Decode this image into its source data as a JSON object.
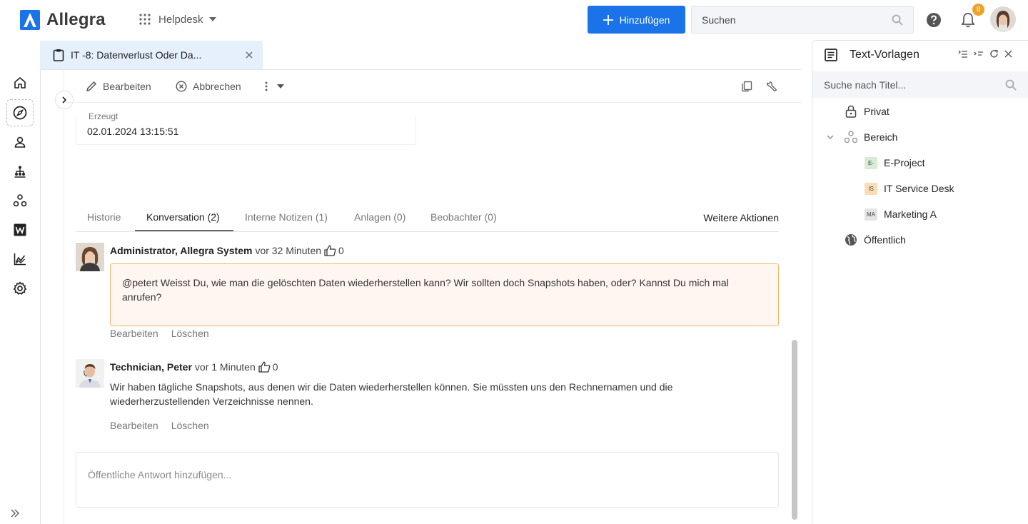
{
  "app": {
    "name": "Allegra",
    "module": "Helpdesk",
    "add_button": "Hinzufügen",
    "search_placeholder": "Suchen",
    "notification_count": "8",
    "brand_color": "#1a73e8"
  },
  "document_tab": {
    "title": "IT -8: Datenverlust Oder Da..."
  },
  "toolbar": {
    "edit": "Bearbeiten",
    "cancel": "Abbrechen"
  },
  "field": {
    "label": "Erzeugt",
    "value": "02.01.2024 13:15:51"
  },
  "conversation_tabs": [
    {
      "label": "Historie"
    },
    {
      "label": "Konversation (2)"
    },
    {
      "label": "Interne Notizen (1)"
    },
    {
      "label": "Anlagen (0)"
    },
    {
      "label": "Beobachter (0)"
    }
  ],
  "more_actions": "Weitere Aktionen",
  "comments": [
    {
      "author": "Administrator, Allegra System",
      "time": "vor 32 Minuten",
      "likes": "0",
      "text": "@petert Weisst Du, wie man die gelöschten Daten wiederherstellen kann? Wir sollten doch Snapshots haben, oder? Kannst Du mich mal anrufen?",
      "edit": "Bearbeiten",
      "delete": "Löschen"
    },
    {
      "author": "Technician, Peter",
      "time": "vor 1 Minuten",
      "likes": "0",
      "text": "Wir haben tägliche Snapshots, aus denen wir die Daten wiederherstellen können. Sie müssten uns den Rechnernamen und die wiederherzustellenden Verzeichnisse nennen.",
      "edit": "Bearbeiten",
      "delete": "Löschen"
    }
  ],
  "reply_placeholder": "Öffentliche Antwort hinzufügen...",
  "right_panel": {
    "title": "Text-Vorlagen",
    "search_placeholder": "Suche nach Titel...",
    "tree": [
      {
        "label": "Privat",
        "icon": "lock-icon"
      },
      {
        "label": "Bereich",
        "icon": "group-icon"
      },
      {
        "label": "E-Project",
        "chip": "E-",
        "chip_color": "#d7ecd4"
      },
      {
        "label": "IT Service Desk",
        "chip": "IS",
        "chip_color": "#fcdcb4"
      },
      {
        "label": "Marketing A",
        "chip": "MA",
        "chip_color": "#e4e4e4"
      },
      {
        "label": "Öffentlich",
        "icon": "globe-icon"
      }
    ]
  }
}
